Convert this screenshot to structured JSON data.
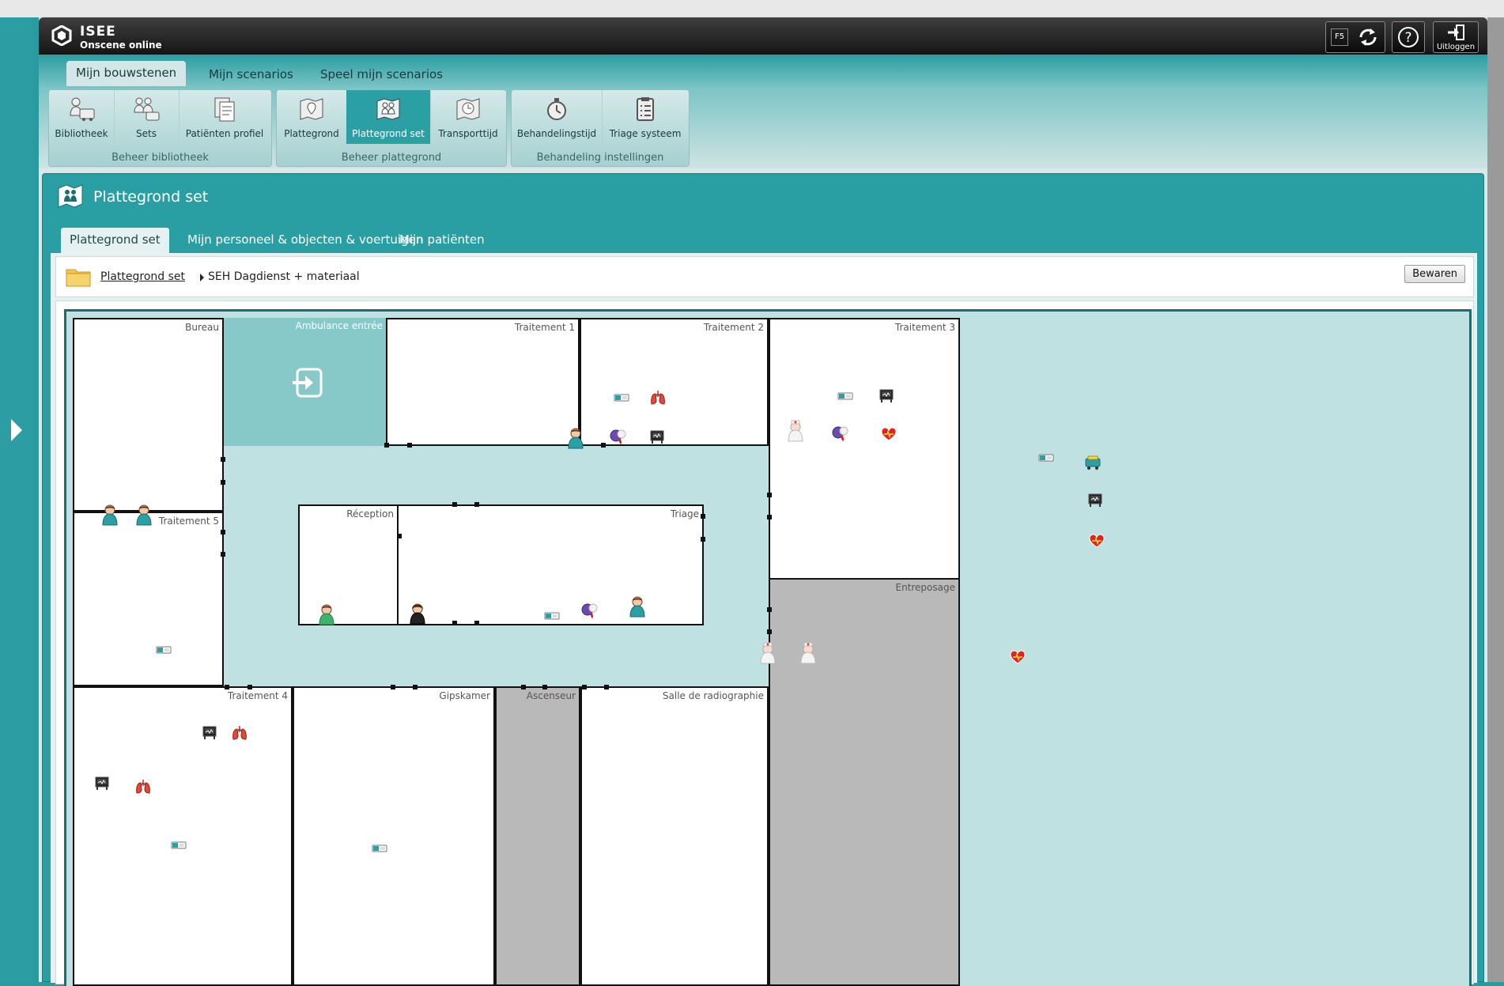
{
  "app": {
    "logo_line1": "ISEE",
    "logo_line2": "Onscene online"
  },
  "topbar_buttons": {
    "f5": "F5",
    "help": "?",
    "logout": "Uitloggen"
  },
  "nav_tabs": [
    "Mijn bouwstenen",
    "Mijn scenarios",
    "Speel mijn scenarios"
  ],
  "groups": [
    {
      "caption": "Beheer bibliotheek",
      "tools": [
        "Bibliotheek",
        "Sets",
        "Patiënten profiel"
      ]
    },
    {
      "caption": "Beheer plattegrond",
      "tools": [
        "Plattegrond",
        "Plattegrond set",
        "Transporttijd"
      ]
    },
    {
      "caption": "Behandeling instellingen",
      "tools": [
        "Behandelingstijd",
        "Triage systeem"
      ]
    }
  ],
  "panel": {
    "title": "Plattegrond set",
    "tabs": [
      "Plattegrond set",
      "Mijn personeel & objecten & voertuigen",
      "Mijn patiënten"
    ],
    "breadcrumb": {
      "root": "Plattegrond set",
      "current": "SEH Dagdienst + materiaal"
    },
    "save_label": "Bewaren"
  },
  "rooms": {
    "bureau": "Bureau",
    "ambulance": "Ambulance entrée",
    "t1": "Traitement 1",
    "t2": "Traitement 2",
    "t3": "Traitement 3",
    "t5": "Traitement 5",
    "reception": "Réception",
    "triage": "Triage",
    "entreposage": "Entreposage",
    "t4": "Traitement 4",
    "gips": "Gipskamer",
    "asc": "Ascenseur",
    "radio": "Salle de radiographie"
  },
  "colors": {
    "accent": "#2a9fa3",
    "active_tool": "#2aa0a5",
    "map_floor": "#bfe1e1"
  }
}
